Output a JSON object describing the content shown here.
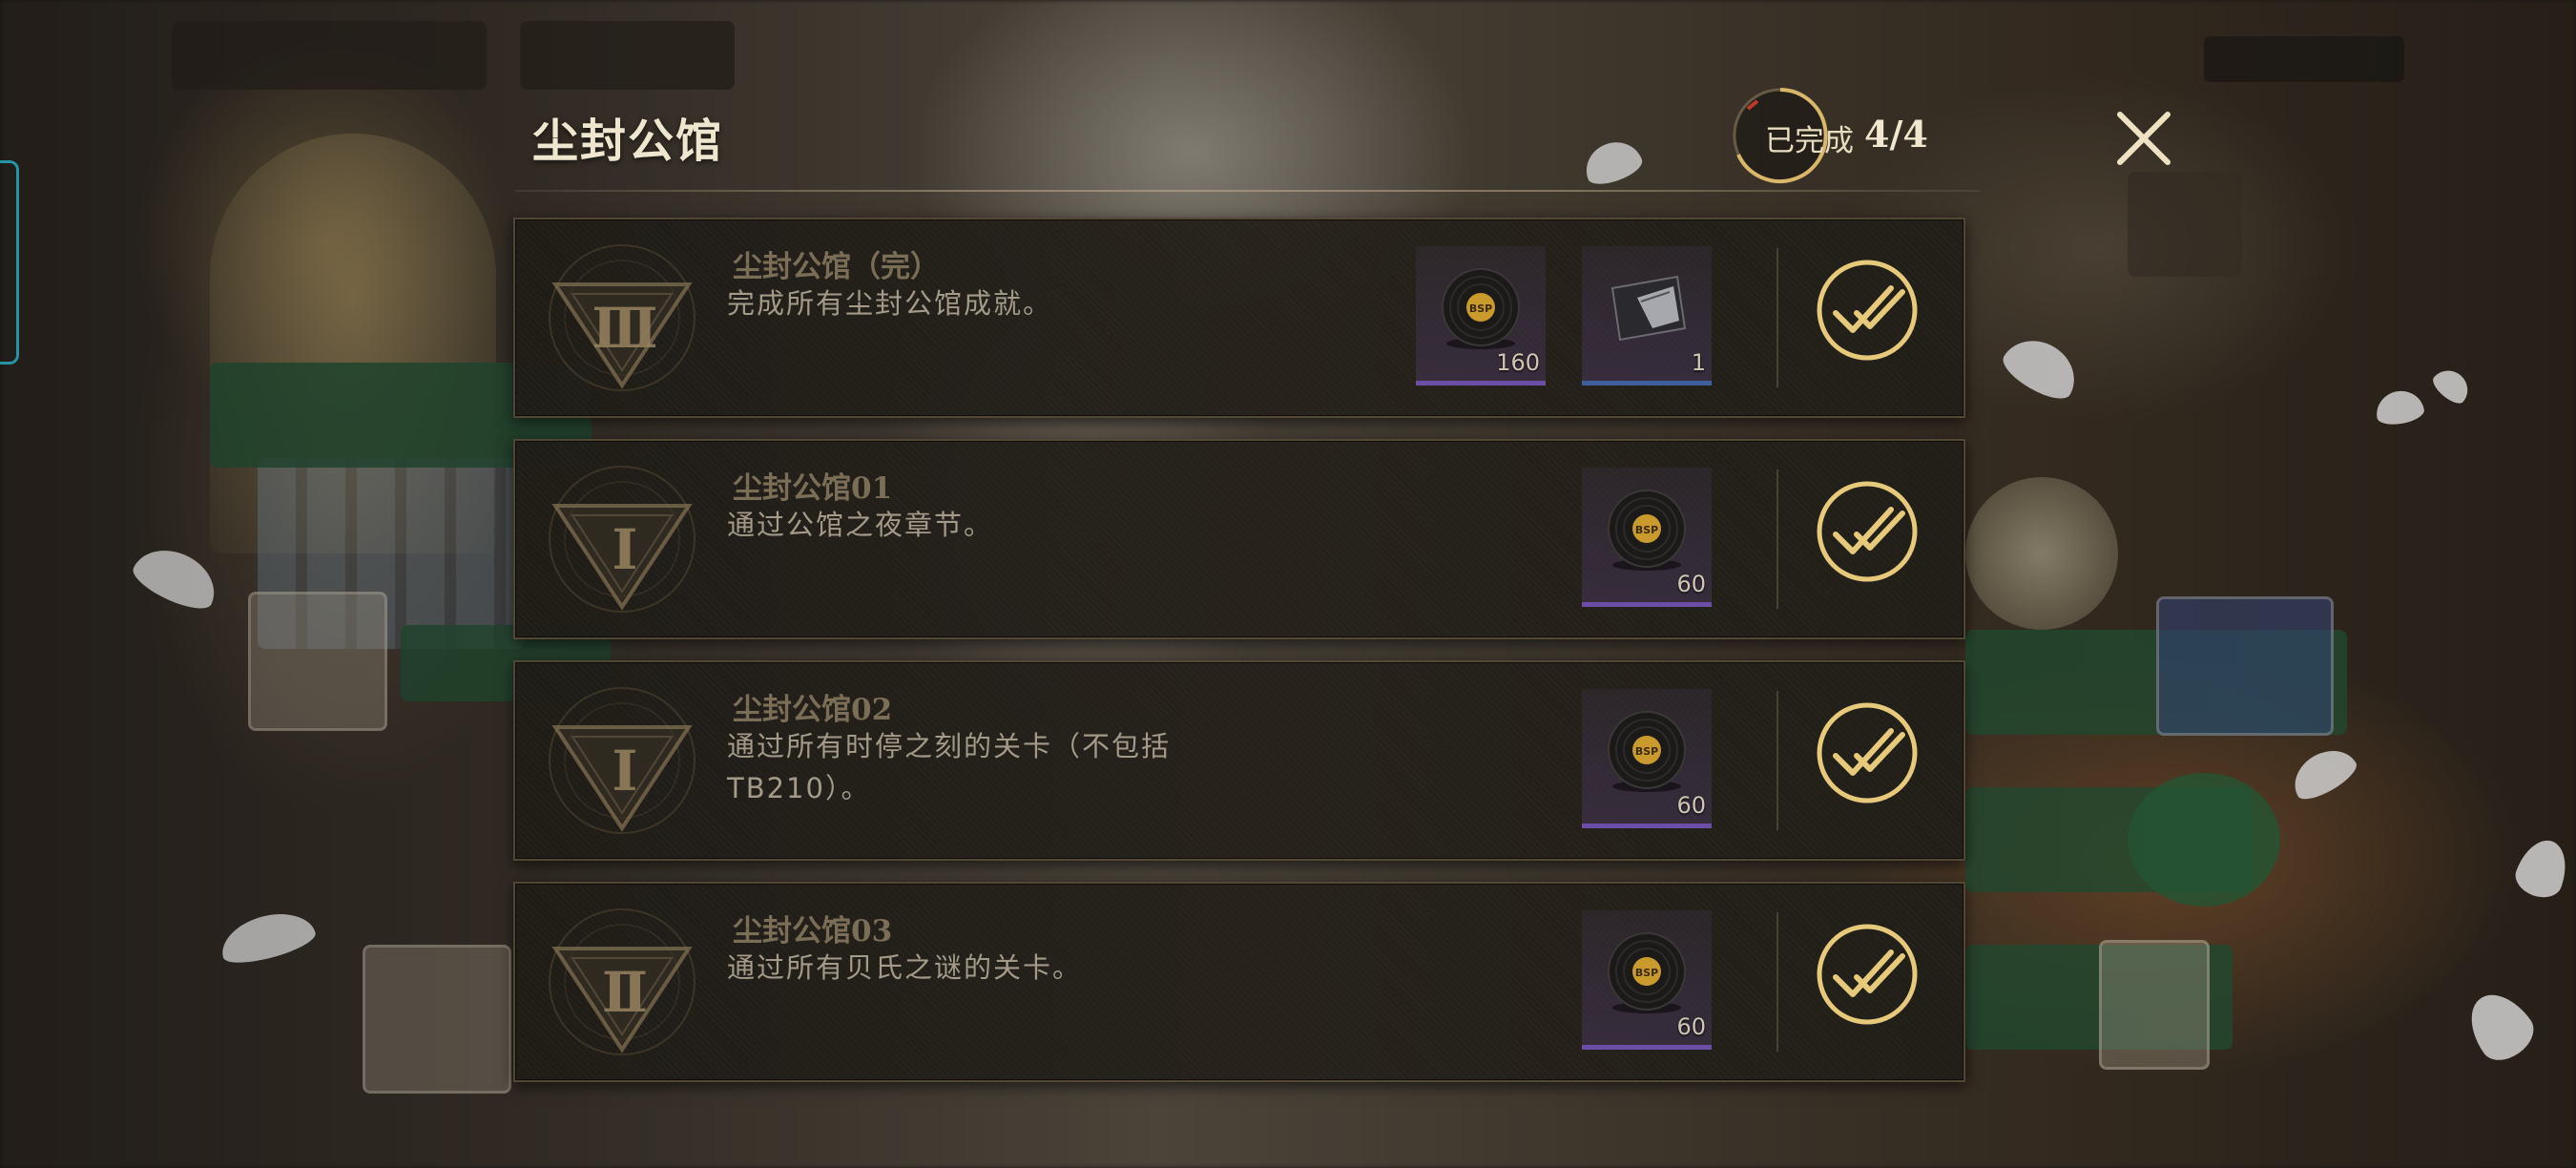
{
  "panel": {
    "title": "尘封公馆",
    "progress_label": "已完成",
    "progress_count": "4/4",
    "close_icon": "close-icon"
  },
  "colors": {
    "gold": "#e6c97a",
    "title_text": "#efe6cf",
    "row_title": "#7a6e57",
    "row_desc": "#a39a88",
    "reward_purple": "#6c4ea6",
    "reward_blue": "#3f5f9c",
    "side_accent": "#2fc2d8"
  },
  "achievements": [
    {
      "title": "尘封公馆（完）",
      "description": "完成所有尘封公馆成就。",
      "badge_numeral": "III",
      "completed": true,
      "rewards": [
        {
          "icon": "vinyl-record-icon",
          "quantity": "160",
          "rarity": "purple"
        },
        {
          "icon": "dark-card-icon",
          "quantity": "1",
          "rarity": "blue"
        }
      ]
    },
    {
      "title": "尘封公馆01",
      "description": "通过公馆之夜章节。",
      "badge_numeral": "I",
      "completed": true,
      "rewards": [
        {
          "icon": "vinyl-record-icon",
          "quantity": "60",
          "rarity": "purple"
        }
      ]
    },
    {
      "title": "尘封公馆02",
      "description": "通过所有时停之刻的关卡（不包括TB210）。",
      "badge_numeral": "I",
      "completed": true,
      "rewards": [
        {
          "icon": "vinyl-record-icon",
          "quantity": "60",
          "rarity": "purple"
        }
      ]
    },
    {
      "title": "尘封公馆03",
      "description": "通过所有贝氏之谜的关卡。",
      "badge_numeral": "II",
      "completed": true,
      "rewards": [
        {
          "icon": "vinyl-record-icon",
          "quantity": "60",
          "rarity": "purple"
        }
      ]
    }
  ]
}
